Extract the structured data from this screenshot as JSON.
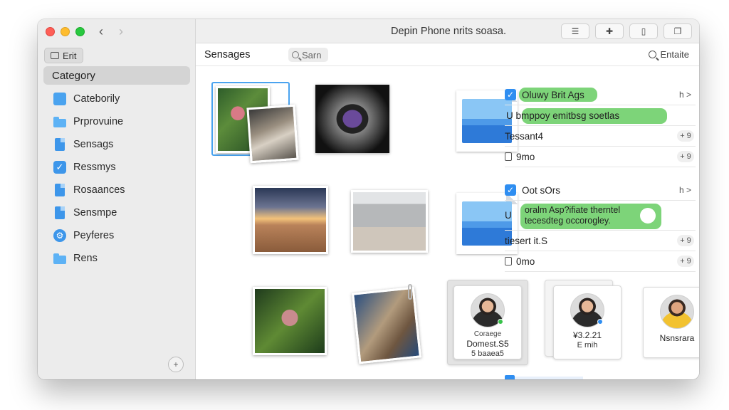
{
  "window": {
    "title": "Depin Phone nrits soasa."
  },
  "sidebar": {
    "edit_label": "Erit",
    "category_header": "Category",
    "items": [
      {
        "label": "Cateborily",
        "icon": "blue-square-icon"
      },
      {
        "label": "Prprovuine",
        "icon": "folder-icon"
      },
      {
        "label": "Sensags",
        "icon": "document-icon"
      },
      {
        "label": "Ressmys",
        "icon": "checkbox-icon"
      },
      {
        "label": "Rosaances",
        "icon": "document-icon"
      },
      {
        "label": "Sensmpe",
        "icon": "document-icon"
      },
      {
        "label": "Peyferes",
        "icon": "gear-icon"
      },
      {
        "label": "Rens",
        "icon": "folder-icon"
      }
    ],
    "add_button_label": "+"
  },
  "toolbar": {
    "section_title": "Sensages",
    "search_placeholder": "Sarn",
    "enable_label": "Entaite"
  },
  "lists": [
    {
      "rows": [
        {
          "text": "Oluwy Brit Ags",
          "right": "h >",
          "checked": true,
          "highlighted": true
        },
        {
          "text": "U bmppoy emitbsg soetlas",
          "highlighted": true
        },
        {
          "text": "Tessant4",
          "right": "+ 9"
        },
        {
          "text": "9mo",
          "right": "+ 9"
        }
      ]
    },
    {
      "rows": [
        {
          "text": "Oot sOrs",
          "right": "h >",
          "checked": true
        },
        {
          "text": "U",
          "overlay_line1": "oralm Asp?ifiate therntel",
          "overlay_line2": "tecesdteg occorogley.",
          "highlighted": true
        },
        {
          "text": "tiesert it.S",
          "right": "+ 9"
        },
        {
          "text": "0mo",
          "right": "+ 9"
        }
      ]
    }
  ],
  "contacts": [
    {
      "line1": "Coraege",
      "line2": "Domest.S5",
      "line3": "5 baaea5",
      "status_color": "#38c24a"
    },
    {
      "line1": "",
      "line2": "¥3.2.21",
      "line3": "E rnih",
      "status_color": "#2f8ef1"
    },
    {
      "line1": "",
      "line2": "Nsnsrara",
      "line3": ""
    }
  ],
  "colors": {
    "accent": "#2f8ef1",
    "highlight_green": "#6fcf6a"
  }
}
